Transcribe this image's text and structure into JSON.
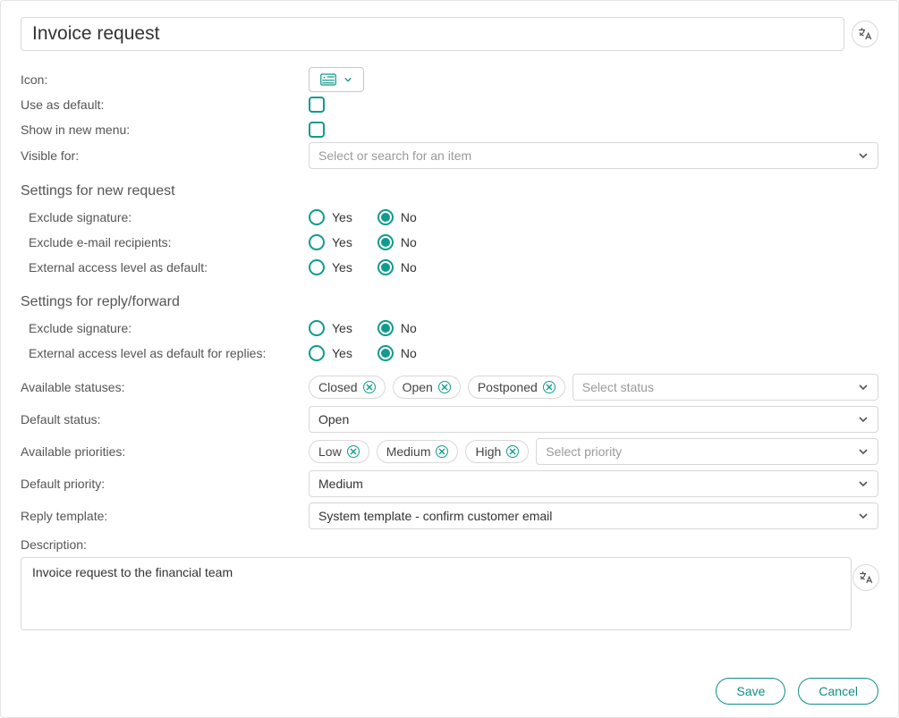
{
  "title": "Invoice request",
  "labels": {
    "icon": "Icon:",
    "use_as_default": "Use as default:",
    "show_in_new_menu": "Show in new menu:",
    "visible_for": "Visible for:",
    "available_statuses": "Available statuses:",
    "default_status": "Default status:",
    "available_priorities": "Available priorities:",
    "default_priority": "Default priority:",
    "reply_template": "Reply template:",
    "description": "Description:"
  },
  "sections": {
    "new_request": "Settings for new request",
    "reply_forward": "Settings for reply/forward"
  },
  "new_request": {
    "exclude_signature": {
      "label": "Exclude signature:",
      "yes": "Yes",
      "no": "No",
      "value": "No"
    },
    "exclude_recipients": {
      "label": "Exclude e-mail recipients:",
      "yes": "Yes",
      "no": "No",
      "value": "No"
    },
    "external_access": {
      "label": "External access level as default:",
      "yes": "Yes",
      "no": "No",
      "value": "No"
    }
  },
  "reply_forward": {
    "exclude_signature": {
      "label": "Exclude signature:",
      "yes": "Yes",
      "no": "No",
      "value": "No"
    },
    "external_access_replies": {
      "label": "External access level as default for replies:",
      "yes": "Yes",
      "no": "No",
      "value": "No"
    }
  },
  "visible_for": {
    "placeholder": "Select or search for an item"
  },
  "statuses": {
    "tags": [
      "Closed",
      "Open",
      "Postponed"
    ],
    "placeholder": "Select status"
  },
  "default_status": "Open",
  "priorities": {
    "tags": [
      "Low",
      "Medium",
      "High"
    ],
    "placeholder": "Select priority"
  },
  "default_priority": "Medium",
  "reply_template": "System template - confirm customer email",
  "description_value": "Invoice request to the financial team",
  "footer": {
    "save": "Save",
    "cancel": "Cancel"
  }
}
